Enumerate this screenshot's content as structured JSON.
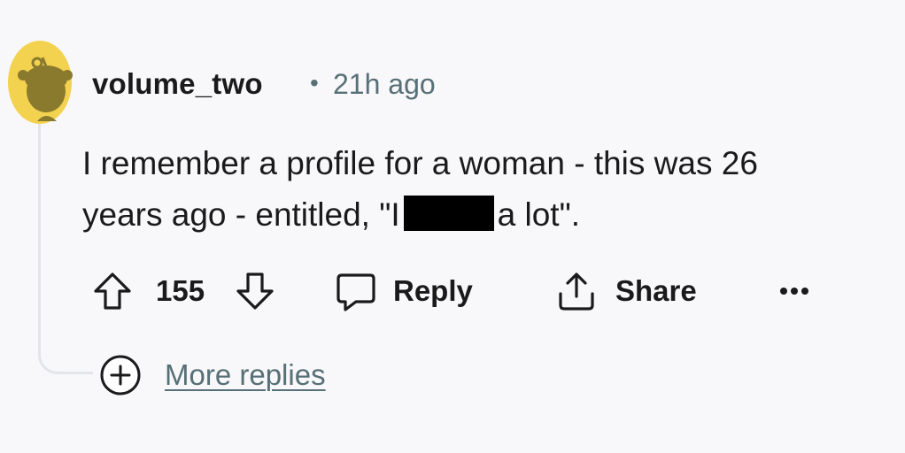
{
  "comment": {
    "author": "volume_two",
    "separator": "•",
    "timestamp": "21h ago",
    "body_line1": "I remember a profile for a woman - this was 26",
    "body_line2_before": "years ago - entitled, \"I",
    "body_line2_after": "a lot\"."
  },
  "actions": {
    "score": "155",
    "reply_label": "Reply",
    "share_label": "Share",
    "more_options": "•••"
  },
  "more_replies_label": "More replies",
  "colors": {
    "background": "#f8f8fa",
    "avatar_yellow": "#f2d24e",
    "avatar_olive": "#8a7a2e",
    "text": "#1a1a1b",
    "muted": "#576f76"
  },
  "icons": {
    "upvote": "arrow-up-icon",
    "downvote": "arrow-down-icon",
    "reply": "speech-bubble-icon",
    "share": "share-icon",
    "more": "ellipsis-icon",
    "expand": "plus-circle-icon"
  }
}
